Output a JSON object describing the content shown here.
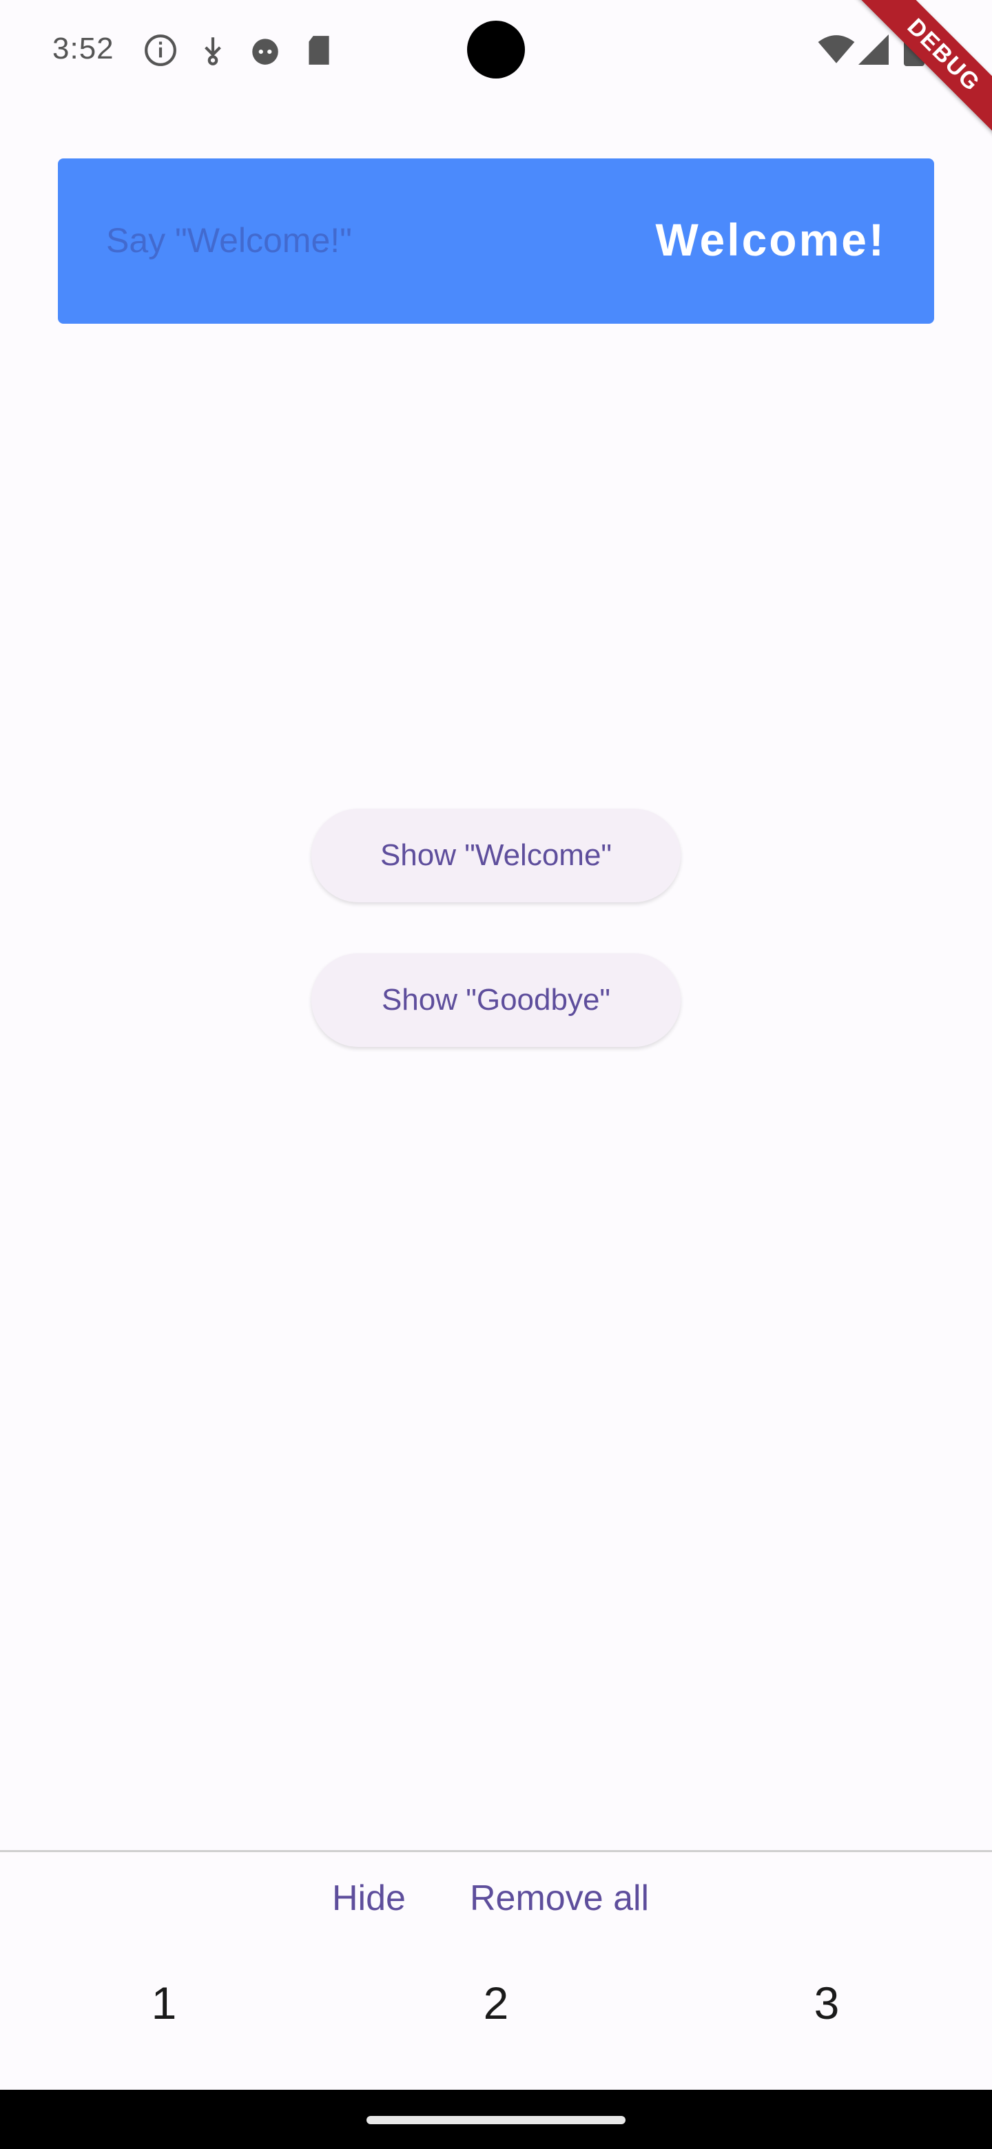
{
  "status_bar": {
    "time": "3:52",
    "icons": [
      "info-icon",
      "download-icon",
      "android-head-icon",
      "sd-card-icon"
    ],
    "right_icons": [
      "wifi-icon",
      "signal-icon",
      "battery-icon"
    ]
  },
  "debug_banner": {
    "label": "DEBUG"
  },
  "banner": {
    "content": "Say \"Welcome!\"",
    "action": "Welcome!",
    "background": "#4b8afc"
  },
  "buttons": {
    "show_welcome": "Show \"Welcome\"",
    "show_goodbye": "Show \"Goodbye\""
  },
  "bottom_actions": {
    "hide": "Hide",
    "remove_all": "Remove all"
  },
  "tabs": [
    "1",
    "2",
    "3"
  ],
  "colors": {
    "accent": "#5e4e9c",
    "surface": "#fdfbfe",
    "button_bg": "#f5eff7"
  }
}
